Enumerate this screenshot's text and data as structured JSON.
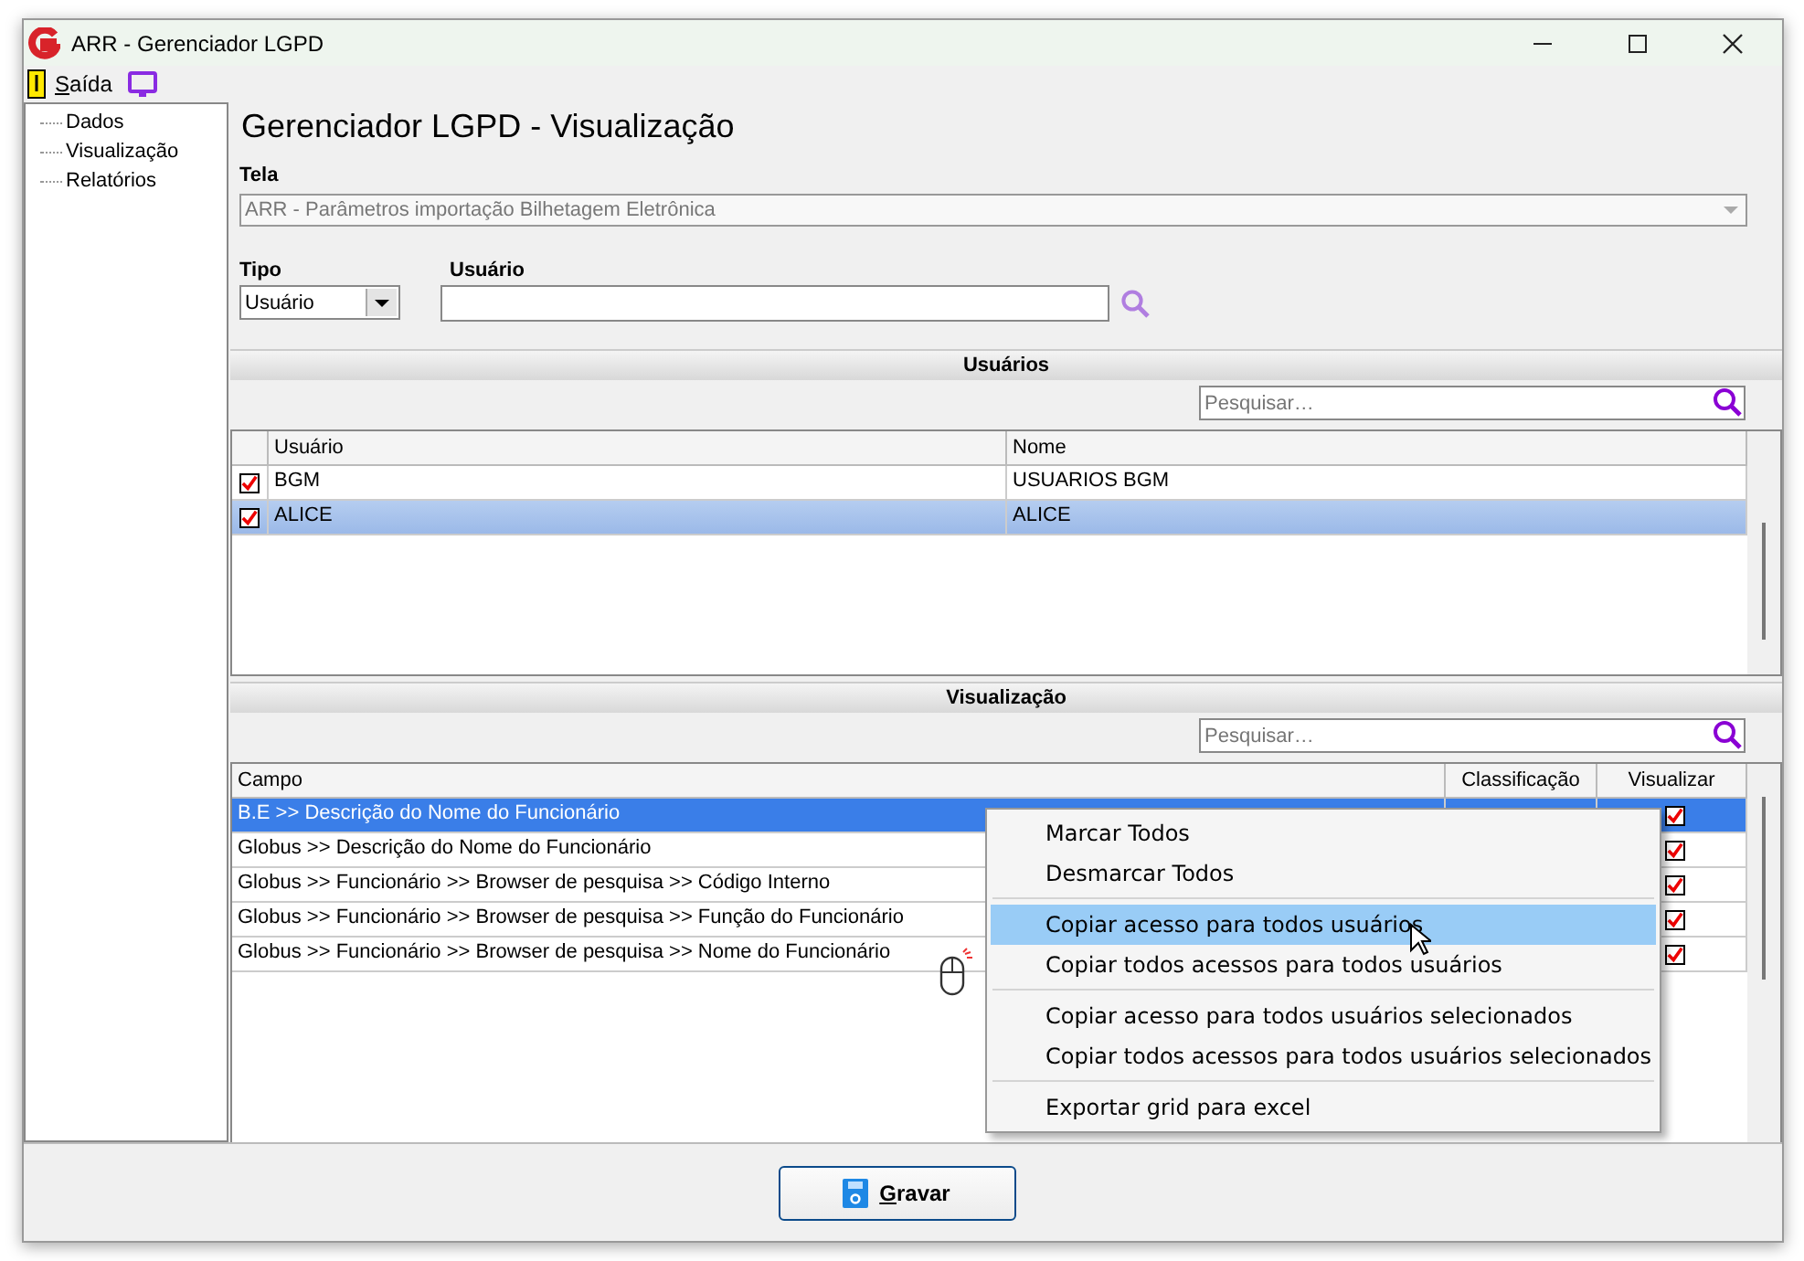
{
  "window": {
    "title": "ARR - Gerenciador LGPD"
  },
  "toolbar": {
    "exit_label": "Saída"
  },
  "sidebar": {
    "items": [
      {
        "label": "Dados"
      },
      {
        "label": "Visualização"
      },
      {
        "label": "Relatórios"
      }
    ]
  },
  "page_title": "Gerenciador LGPD - Visualização",
  "tela": {
    "label": "Tela",
    "value": "ARR - Parâmetros importação Bilhetagem Eletrônica",
    "disabled": true
  },
  "tipo": {
    "label": "Tipo",
    "value": "Usuário"
  },
  "usuario": {
    "label": "Usuário"
  },
  "users_section": {
    "title": "Usuários",
    "search_placeholder": "Pesquisar…",
    "columns": [
      "Usuário",
      "Nome"
    ],
    "rows": [
      {
        "checked": true,
        "selected": false,
        "cells": [
          "BGM",
          "USUARIOS BGM"
        ]
      },
      {
        "checked": true,
        "selected": true,
        "cells": [
          "ALICE",
          "ALICE"
        ]
      }
    ]
  },
  "fields_section": {
    "title": "Visualização",
    "search_placeholder": "Pesquisar…",
    "columns": [
      "Campo",
      "Classificação",
      "Visualizar"
    ],
    "rows": [
      {
        "campo": "B.E >> Descrição do Nome do Funcionário",
        "visualizar": true,
        "selected": true
      },
      {
        "campo": "Globus >> Descrição do Nome do Funcionário",
        "visualizar": true,
        "selected": false
      },
      {
        "campo": "Globus >> Funcionário >> Browser de pesquisa >> Código Interno",
        "visualizar": true,
        "selected": false
      },
      {
        "campo": "Globus >> Funcionário >> Browser de pesquisa >> Função do Funcionário",
        "visualizar": true,
        "selected": false
      },
      {
        "campo": "Globus >> Funcionário >> Browser de pesquisa >> Nome do Funcionário",
        "visualizar": true,
        "selected": false
      }
    ]
  },
  "context_menu": {
    "groups": [
      [
        {
          "label": "Marcar Todos",
          "selected": false
        },
        {
          "label": "Desmarcar Todos",
          "selected": false
        }
      ],
      [
        {
          "label": "Copiar acesso para todos usuários",
          "selected": true
        },
        {
          "label": "Copiar todos acessos para todos usuários",
          "selected": false
        }
      ],
      [
        {
          "label": "Copiar acesso para todos usuários selecionados",
          "selected": false
        },
        {
          "label": "Copiar todos acessos para todos usuários selecionados",
          "selected": false
        }
      ],
      [
        {
          "label": "Exportar grid para excel",
          "selected": false
        }
      ]
    ]
  },
  "save_button": {
    "label": "Gravar"
  }
}
